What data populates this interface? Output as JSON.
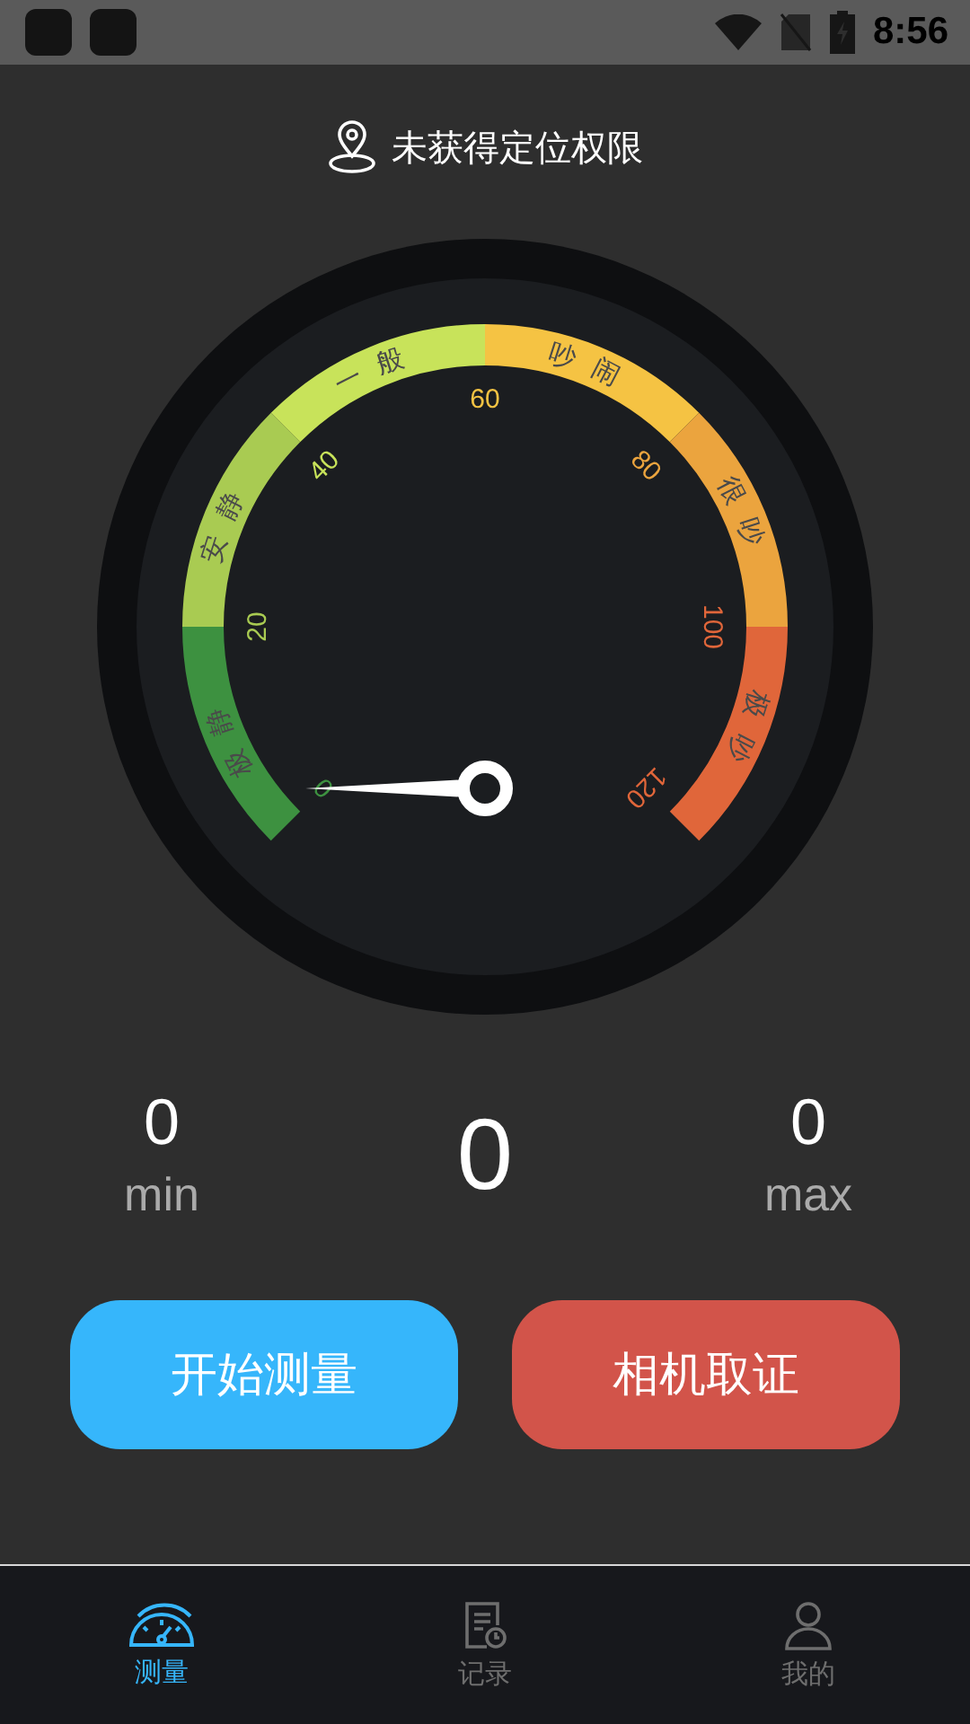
{
  "status_bar": {
    "time": "8:56"
  },
  "location_notice": "未获得定位权限",
  "gauge": {
    "ticks": [
      "0",
      "20",
      "40",
      "60",
      "80",
      "100",
      "120"
    ],
    "bands": [
      {
        "label": "极静",
        "color": "#3d9140"
      },
      {
        "label": "安静",
        "color": "#a9cb52"
      },
      {
        "label": "一般",
        "color": "#c8e35a"
      },
      {
        "label": "吵闹",
        "color": "#f5c343"
      },
      {
        "label": "很吵",
        "color": "#eba43e"
      },
      {
        "label": "极吵",
        "color": "#e0663a"
      }
    ]
  },
  "stats": {
    "min": {
      "value": "0",
      "label": "min"
    },
    "current": "0",
    "max": {
      "value": "0",
      "label": "max"
    }
  },
  "buttons": [
    {
      "label": "开始测量",
      "kind": "primary"
    },
    {
      "label": "相机取证",
      "kind": "danger"
    }
  ],
  "nav": [
    {
      "label": "测量",
      "kind": "gauge",
      "selected": true
    },
    {
      "label": "记录",
      "kind": "record",
      "selected": false
    },
    {
      "label": "我的",
      "kind": "profile",
      "selected": false
    }
  ]
}
